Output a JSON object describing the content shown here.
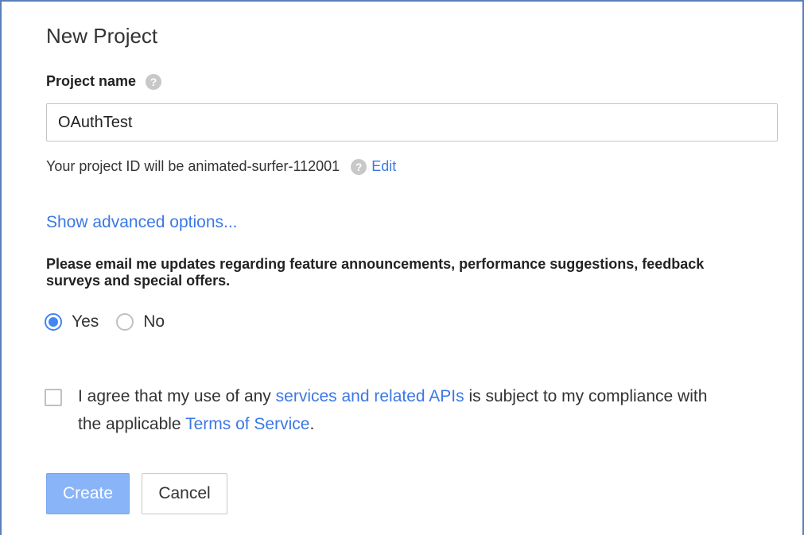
{
  "dialog": {
    "title": "New Project"
  },
  "project_name": {
    "label": "Project name",
    "help_icon": "help-icon",
    "value": "OAuthTest",
    "placeholder": ""
  },
  "project_id": {
    "text": "Your project ID will be animated-surfer-112001",
    "help_icon": "help-icon",
    "edit_link": "Edit"
  },
  "advanced": {
    "link": "Show advanced options..."
  },
  "email_updates": {
    "prompt": "Please email me updates regarding feature announcements, performance suggestions, feedback surveys and special offers.",
    "options": [
      {
        "label": "Yes",
        "selected": true
      },
      {
        "label": "No",
        "selected": false
      }
    ]
  },
  "agreement": {
    "checked": false,
    "text_before": "I agree that my use of any ",
    "link1": "services and related APIs",
    "text_middle": " is subject to my compliance with the applicable ",
    "link2": "Terms of Service",
    "text_after": "."
  },
  "buttons": {
    "create": "Create",
    "cancel": "Cancel"
  },
  "colors": {
    "link": "#3b78e7",
    "radio_selected": "#4285f4",
    "create_button": "#8ab4f8",
    "frame_border": "#5a7fb8"
  }
}
